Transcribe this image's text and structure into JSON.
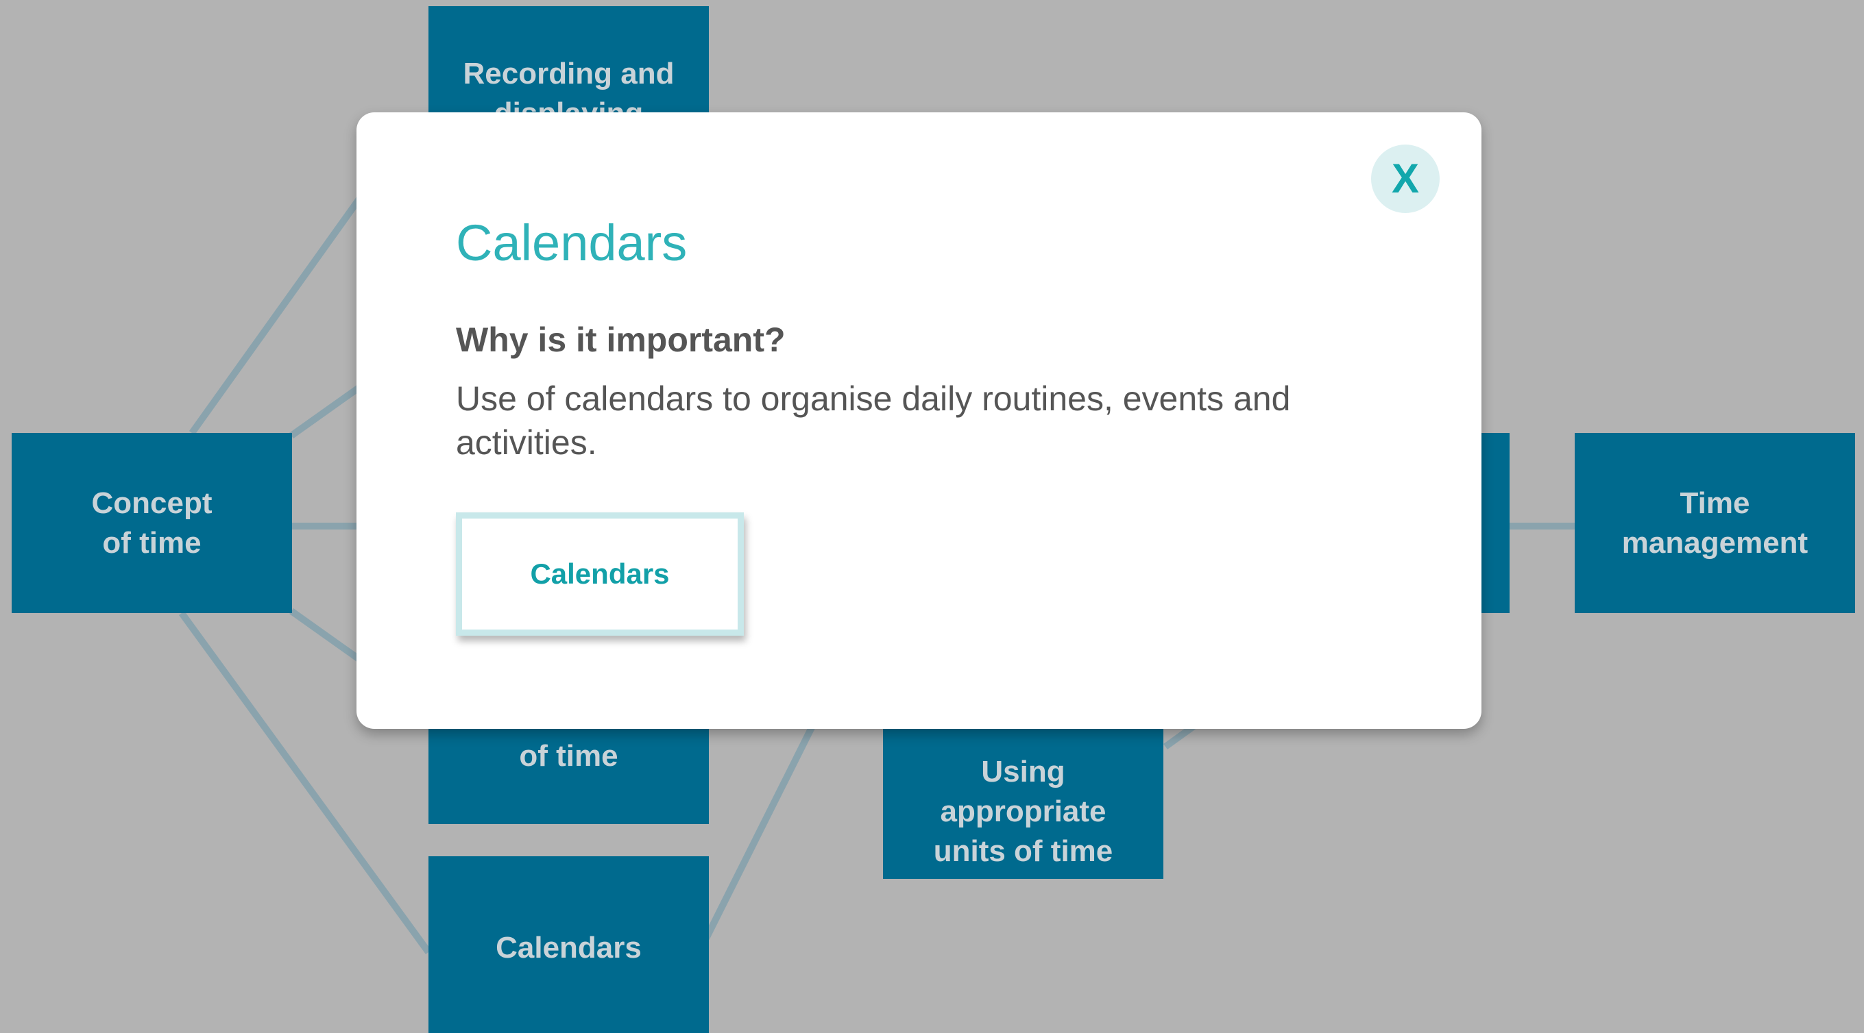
{
  "background_nodes": {
    "concept_of_time": [
      "Concept",
      "of time"
    ],
    "recording_displaying": [
      "Recording and",
      "displaying"
    ],
    "units_of_time": [
      "of time"
    ],
    "calendars": [
      "Calendars"
    ],
    "using_units": [
      "Using appropriate",
      "units of time"
    ],
    "time_management": [
      "Time",
      "management"
    ]
  },
  "modal": {
    "close_label": "X",
    "title": "Calendars",
    "subtitle": "Why is it important?",
    "body": "Use of calendars to organise daily routines, events and activities.",
    "link_button_label": "Calendars"
  },
  "colors": {
    "background": "#b3b3b3",
    "node_fill": "#006a8e",
    "connector": "#8aa3ad",
    "accent_teal": "#2fb2b8",
    "close_button_bg": "#dcf0f1"
  }
}
